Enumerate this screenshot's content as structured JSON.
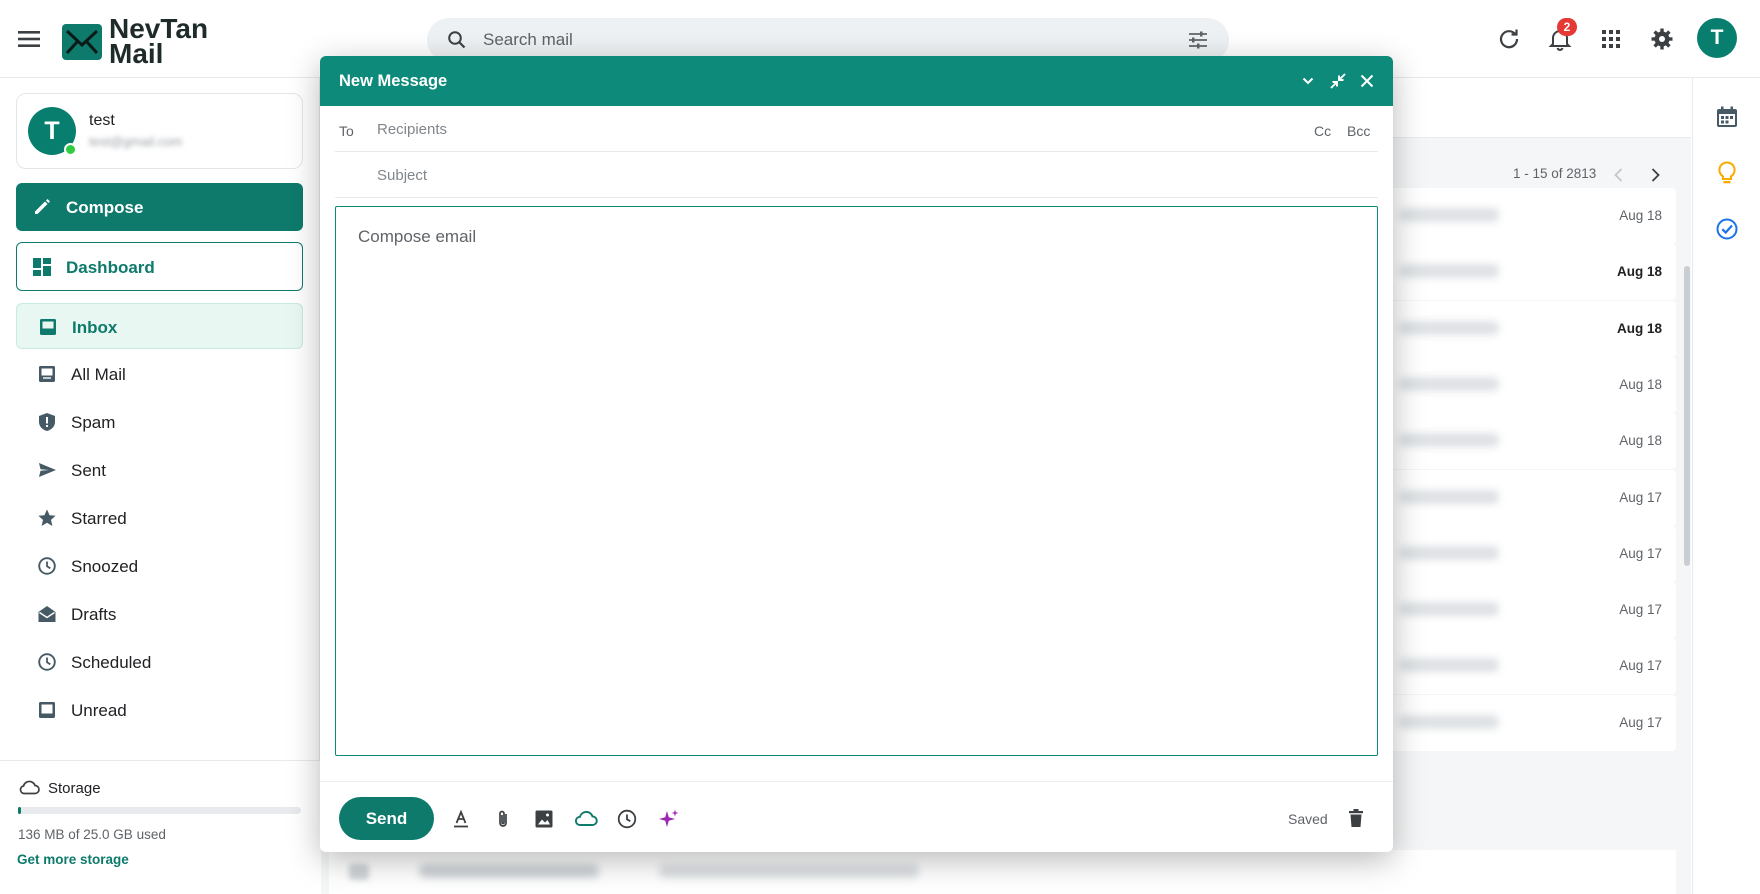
{
  "app": {
    "logo_line1": "NevTan",
    "logo_line2": "Mail"
  },
  "search": {
    "placeholder": "Search mail"
  },
  "header": {
    "notification_count": "2",
    "user_initial": "T"
  },
  "account": {
    "initial": "T",
    "name": "test",
    "email": "test@gmail.com"
  },
  "sidebar": {
    "compose_label": "Compose",
    "dashboard_label": "Dashboard",
    "items": [
      {
        "label": "Inbox",
        "icon": "inbox-icon"
      },
      {
        "label": "All Mail",
        "icon": "all-mail-icon"
      },
      {
        "label": "Spam",
        "icon": "spam-icon"
      },
      {
        "label": "Sent",
        "icon": "send-icon"
      },
      {
        "label": "Starred",
        "icon": "star-icon"
      },
      {
        "label": "Snoozed",
        "icon": "clock-icon"
      },
      {
        "label": "Drafts",
        "icon": "drafts-icon"
      },
      {
        "label": "Scheduled",
        "icon": "clock-icon"
      },
      {
        "label": "Unread",
        "icon": "unread-icon"
      }
    ]
  },
  "storage": {
    "title": "Storage",
    "used_text": "136 MB of 25.0 GB used",
    "used_fraction": 0.0054,
    "more_label": "Get more storage"
  },
  "mail_list": {
    "pager": "1 - 15 of 2813",
    "rows": [
      {
        "date": "Aug 18",
        "unread": false
      },
      {
        "date": "Aug 18",
        "unread": true
      },
      {
        "date": "Aug 18",
        "unread": true
      },
      {
        "date": "Aug 18",
        "unread": false
      },
      {
        "date": "Aug 18",
        "unread": false
      },
      {
        "date": "Aug 17",
        "unread": false
      },
      {
        "date": "Aug 17",
        "unread": false
      },
      {
        "date": "Aug 17",
        "unread": false
      },
      {
        "date": "Aug 17",
        "unread": false
      },
      {
        "date": "Aug 17",
        "unread": false
      }
    ]
  },
  "compose": {
    "title": "New Message",
    "to_label": "To",
    "recipients_placeholder": "Recipients",
    "cc_label": "Cc",
    "bcc_label": "Bcc",
    "subject_placeholder": "Subject",
    "body_placeholder": "Compose email",
    "send_label": "Send",
    "status": "Saved"
  },
  "colors": {
    "brand": "#0e7a6c",
    "header_bar": "#0e8a7a",
    "badge": "#e53935",
    "ai_sparkle": "#9c27b0",
    "rail_calendar": "#455a64",
    "rail_keep": "#f9ab00",
    "rail_tasks": "#1a73e8"
  }
}
